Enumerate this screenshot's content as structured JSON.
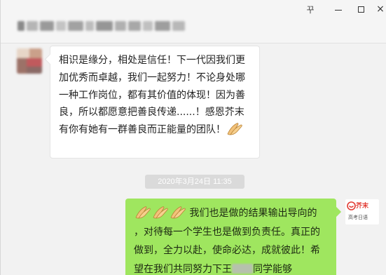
{
  "window": {
    "pin_glyph": "꾸",
    "close_glyph": "×"
  },
  "messages": {
    "left": {
      "text": "相识是缘分，相处是信任！下一代因我们更加优秀而卓越，我们一起努力！不论身处哪一种工作岗位，都有其价值的体现！因为善良，所以都愿意把善良传递......！感恩芥末有你有她有一群善良而正能量的团队！",
      "emoji": "clap-icon"
    },
    "timestamp": "2020年3月24日  11:35",
    "right": {
      "text_part1": "我们也是做的结果输出导向的 ，对待每一个学生也是做到负责任。真正的做到，全力以赴，使命必达，成就彼此！希望在我们共同努力下王",
      "text_part2": "同学能够",
      "emoji_count": 3
    }
  },
  "sender_logo": {
    "name": "芥末",
    "subtitle": "高考日语"
  },
  "colors": {
    "background": "#f2f2f2",
    "bubble_left": "#ffffff",
    "bubble_right": "#9fe65f",
    "timestamp_bg": "#dadada",
    "logo_red": "#e23c34"
  }
}
